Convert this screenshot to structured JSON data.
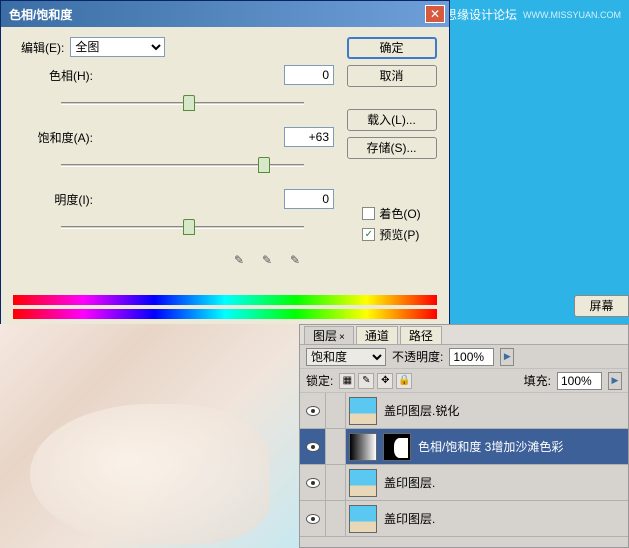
{
  "dialog": {
    "title": "色相/饱和度",
    "edit_label": "编辑(E):",
    "edit_value": "全图",
    "hue_label": "色相(H):",
    "hue_value": "0",
    "sat_label": "饱和度(A):",
    "sat_value": "+63",
    "light_label": "明度(I):",
    "light_value": "0",
    "ok": "确定",
    "cancel": "取消",
    "load": "载入(L)...",
    "save": "存储(S)...",
    "colorize": "着色(O)",
    "preview": "预览(P)",
    "preview_checked": "✓"
  },
  "watermark": {
    "text": "思缘设计论坛",
    "url": "WWW.MISSYUAN.COM"
  },
  "screen_btn": "屏幕",
  "layers": {
    "tabs": [
      "图层",
      "通道",
      "路径"
    ],
    "blend_label": "饱和度",
    "opacity_label": "不透明度:",
    "opacity_value": "100%",
    "lock_label": "锁定:",
    "fill_label": "填充:",
    "fill_value": "100%",
    "items": [
      {
        "name": "盖印图层.锐化"
      },
      {
        "name": "色相/饱和度 3增加沙滩色彩"
      },
      {
        "name": "盖印图层."
      },
      {
        "name": "盖印图层."
      }
    ]
  }
}
